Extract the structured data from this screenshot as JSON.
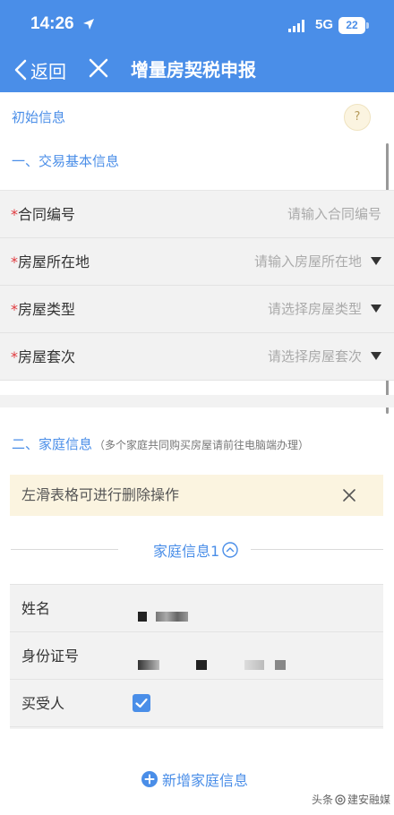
{
  "status_bar": {
    "time": "14:26",
    "network": "5G",
    "battery": "22"
  },
  "nav": {
    "back_label": "返回",
    "title": "增量房契税申报"
  },
  "section_initial": "初始信息",
  "help_label": "?",
  "section1": {
    "title": "一、交易基本信息"
  },
  "form": [
    {
      "required": "*",
      "label": "合同编号",
      "placeholder": "请输入合同编号",
      "has_arrow": false
    },
    {
      "required": "*",
      "label": "房屋所在地",
      "placeholder": "请输入房屋所在地",
      "has_arrow": true
    },
    {
      "required": "*",
      "label": "房屋类型",
      "placeholder": "请选择房屋类型",
      "has_arrow": true
    },
    {
      "required": "*",
      "label": "房屋套次",
      "placeholder": "请选择房屋套次",
      "has_arrow": true
    }
  ],
  "section2": {
    "title": "二、家庭信息",
    "note": "（多个家庭共同购买房屋请前往电脑端办理）"
  },
  "tip": {
    "text": "左滑表格可进行删除操作"
  },
  "family": {
    "title": "家庭信息1",
    "rows": [
      {
        "label": "姓名"
      },
      {
        "label": "身份证号"
      },
      {
        "label": "买受人",
        "checked": true
      }
    ]
  },
  "add_family_label": "新增家庭信息",
  "watermark": {
    "prefix": "头条",
    "suffix": "建安融媒"
  },
  "colors": {
    "primary": "#4a8ee8",
    "required": "#e0393e",
    "tip_bg": "#fbf4e0"
  }
}
